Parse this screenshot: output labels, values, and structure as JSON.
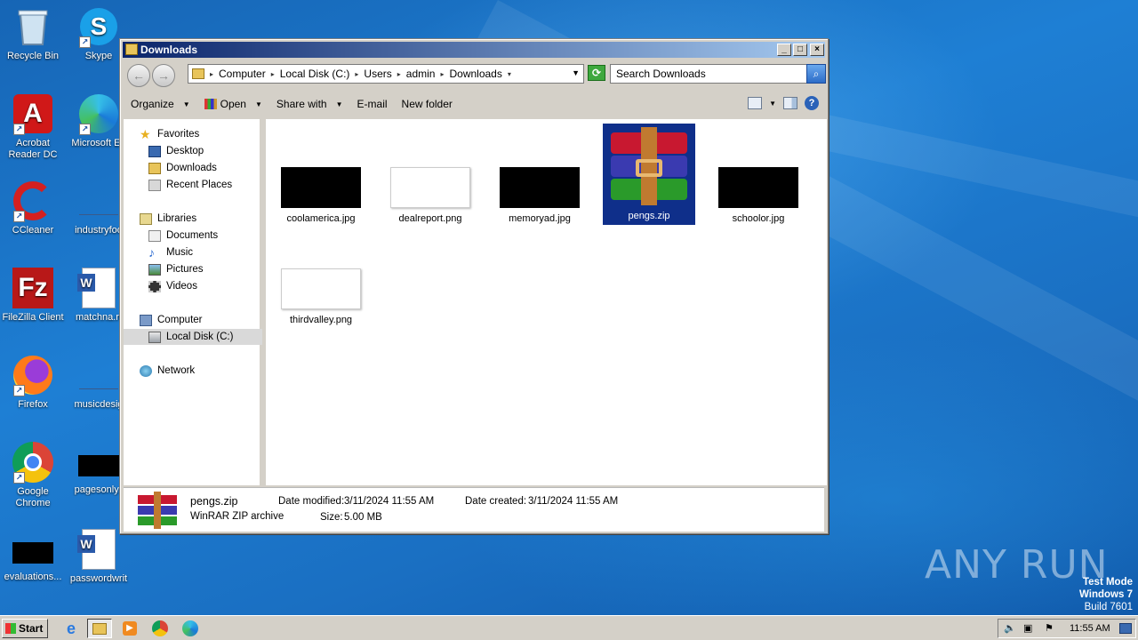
{
  "desktop": {
    "icons": [
      {
        "label": "Recycle Bin",
        "icon": "recycle-bin-icon"
      },
      {
        "label": "Skype",
        "icon": "skype-icon"
      },
      {
        "label": "Acrobat Reader DC",
        "icon": "acrobat-icon"
      },
      {
        "label": "Microsoft Ed",
        "icon": "edge-icon"
      },
      {
        "label": "CCleaner",
        "icon": "ccleaner-icon"
      },
      {
        "label": "industryfoo",
        "icon": "file-icon"
      },
      {
        "label": "FileZilla Client",
        "icon": "filezilla-icon"
      },
      {
        "label": "matchna.rt",
        "icon": "word-doc-icon"
      },
      {
        "label": "Firefox",
        "icon": "firefox-icon"
      },
      {
        "label": "musicdesig",
        "icon": "file-icon"
      },
      {
        "label": "Google Chrome",
        "icon": "chrome-icon"
      },
      {
        "label": "pagesonly.j",
        "icon": "image-file-icon"
      },
      {
        "label": "evaluations...",
        "icon": "image-file-icon"
      },
      {
        "label": "passwordwrit",
        "icon": "word-doc-icon"
      }
    ],
    "watermark": "ANY RUN",
    "test_mode": {
      "line1": "Test Mode",
      "line2": "Windows 7",
      "line3": "Build 7601"
    }
  },
  "window": {
    "title": "Downloads",
    "controls": {
      "minimize": "_",
      "maximize": "□",
      "close": "×"
    },
    "breadcrumbs": [
      "Computer",
      "Local Disk (C:)",
      "Users",
      "admin",
      "Downloads"
    ],
    "search_placeholder": "Search Downloads",
    "toolbar": {
      "organize": "Organize",
      "open": "Open",
      "share_with": "Share with",
      "email": "E-mail",
      "new_folder": "New folder"
    },
    "nav": {
      "favorites": "Favorites",
      "desktop": "Desktop",
      "downloads": "Downloads",
      "recent_places": "Recent Places",
      "libraries": "Libraries",
      "documents": "Documents",
      "music": "Music",
      "pictures": "Pictures",
      "videos": "Videos",
      "computer": "Computer",
      "local_disk": "Local Disk (C:)",
      "network": "Network"
    },
    "files": [
      {
        "name": "coolamerica.jpg",
        "kind": "dark-image"
      },
      {
        "name": "dealreport.png",
        "kind": "light-image"
      },
      {
        "name": "memoryad.jpg",
        "kind": "dark-image"
      },
      {
        "name": "pengs.zip",
        "kind": "winrar-archive",
        "selected": true
      },
      {
        "name": "schoolor.jpg",
        "kind": "dark-image"
      },
      {
        "name": "thirdvalley.png",
        "kind": "light-image"
      }
    ],
    "details": {
      "name": "pengs.zip",
      "type": "WinRAR ZIP archive",
      "modified_label": "Date modified:",
      "modified": "3/11/2024 11:55 AM",
      "created_label": "Date created:",
      "created": "3/11/2024 11:55 AM",
      "size_label": "Size:",
      "size": "5.00 MB"
    }
  },
  "taskbar": {
    "start": "Start",
    "clock": "11:55 AM"
  }
}
